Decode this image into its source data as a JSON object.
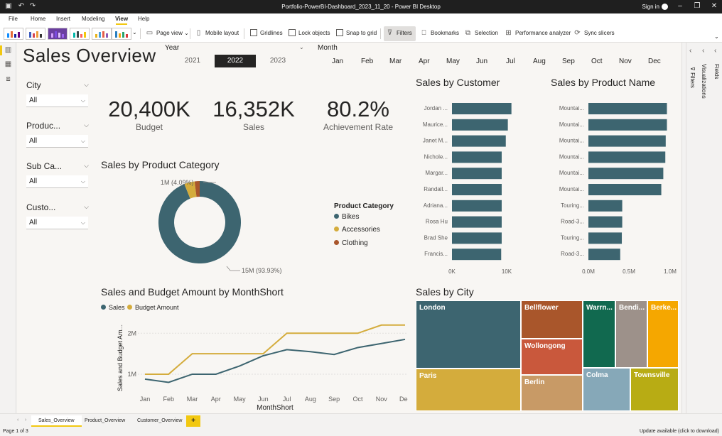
{
  "window": {
    "title": "Portfolio-PowerBI-Dashboard_2023_11_20 - Power BI Desktop",
    "sign_in": "Sign in",
    "min": "–",
    "max": "❐",
    "close": "✕"
  },
  "menu": {
    "file": "File",
    "home": "Home",
    "insert": "Insert",
    "modeling": "Modeling",
    "view": "View",
    "help": "Help"
  },
  "ribbon": {
    "page_view": "Page view",
    "mobile_layout": "Mobile layout",
    "gridlines": "Gridlines",
    "lock_objects": "Lock objects",
    "snap_to_grid": "Snap to grid",
    "filters": "Filters",
    "bookmarks": "Bookmarks",
    "selection": "Selection",
    "performance_analyzer": "Performance analyzer",
    "sync_slicers": "Sync slicers"
  },
  "report": {
    "title": "Sales Overview",
    "year_label": "Year",
    "years": [
      "2021",
      "2022",
      "2023"
    ],
    "month_label": "Month",
    "months": [
      "Jan",
      "Feb",
      "Mar",
      "Apr",
      "May",
      "Jun",
      "Jul",
      "Aug",
      "Sep",
      "Oct",
      "Nov",
      "Dec"
    ],
    "filters": [
      {
        "label": "City",
        "value": "All"
      },
      {
        "label": "Produc...",
        "value": "All"
      },
      {
        "label": "Sub Ca...",
        "value": "All"
      },
      {
        "label": "Custo...",
        "value": "All"
      }
    ],
    "kpis": [
      {
        "value": "20,400K",
        "label": "Budget"
      },
      {
        "value": "16,352K",
        "label": "Sales"
      },
      {
        "value": "80.2%",
        "label": "Achievement Rate"
      }
    ]
  },
  "chart_data": [
    {
      "type": "pie",
      "title": "Sales by Product Category",
      "legend_title": "Product Category",
      "categories": [
        "Bikes",
        "Accessories",
        "Clothing"
      ],
      "values": [
        93.93,
        4.09,
        1.98
      ],
      "colors": [
        "#3d6570",
        "#d4ac3c",
        "#a9562b"
      ],
      "data_labels": [
        "15M (93.93%)",
        "1M (4.09%)"
      ],
      "legend": "right"
    },
    {
      "type": "bar",
      "title": "Sales by Customer",
      "categories": [
        "Jordan ...",
        "Maurice...",
        "Janet M...",
        "Nichole...",
        "Margar...",
        "Randall...",
        "Adriana...",
        "Rosa Hu",
        "Brad She",
        "Francis..."
      ],
      "values": [
        11600,
        10900,
        10500,
        9700,
        9700,
        9700,
        9700,
        9700,
        9700,
        9600
      ],
      "xlim": [
        0,
        14000
      ],
      "ticks": [
        "0K",
        "10K"
      ],
      "color": "#3d6570"
    },
    {
      "type": "bar",
      "title": "Sales by Product Name",
      "categories": [
        "Mountai...",
        "Mountai...",
        "Mountai...",
        "Mountai...",
        "Mountai...",
        "Mountai...",
        "Touring...",
        "Road-3...",
        "Touring...",
        "Road-3..."
      ],
      "values": [
        975000,
        975000,
        960000,
        955000,
        930000,
        905000,
        420000,
        420000,
        415000,
        395000
      ],
      "xlim": [
        0,
        1050000
      ],
      "ticks": [
        "0.0M",
        "0.5M",
        "1.0M"
      ],
      "color": "#3d6570"
    },
    {
      "type": "line",
      "title": "Sales and Budget Amount by MonthShort",
      "xlabel": "MonthShort",
      "ylabel": "Sales and Budget Am...",
      "x": [
        "Jan",
        "Feb",
        "Mar",
        "Apr",
        "May",
        "Jun",
        "Jul",
        "Aug",
        "Sep",
        "Oct",
        "Nov",
        "Dec"
      ],
      "ylim": [
        0.6,
        2.3
      ],
      "y_ticks": [
        "1M",
        "2M"
      ],
      "series": [
        {
          "name": "Sales",
          "color": "#3d6570",
          "values": [
            0.88,
            0.8,
            1.0,
            1.0,
            1.2,
            1.45,
            1.6,
            1.55,
            1.48,
            1.65,
            1.75,
            1.85
          ]
        },
        {
          "name": "Budget Amount",
          "color": "#d4ac3c",
          "values": [
            1.0,
            1.0,
            1.5,
            1.5,
            1.5,
            1.5,
            2.0,
            2.0,
            2.0,
            2.0,
            2.2,
            2.2
          ]
        }
      ]
    },
    {
      "type": "treemap",
      "title": "Sales by City",
      "categories": [
        "London",
        "Paris",
        "Bellflower",
        "Wollongong",
        "Berlin",
        "Warrn...",
        "Bendi...",
        "Berke...",
        "Colma",
        "Townsville"
      ],
      "colors": [
        "#3d6570",
        "#d4ac3c",
        "#a9562b",
        "#c9583c",
        "#c89a66",
        "#11694f",
        "#9d918a",
        "#f5a700",
        "#86a8b8",
        "#b8ac14"
      ]
    }
  ],
  "pages": {
    "tabs": [
      "Sales_Overview",
      "Product_Overview",
      "Customer_Overview"
    ],
    "add": "+"
  },
  "panes": {
    "filters": "Filters",
    "visualizations": "Visualizations",
    "fields": "Fields"
  },
  "status": {
    "page": "Page 1 of 3",
    "update": "Update available (click to download)"
  }
}
